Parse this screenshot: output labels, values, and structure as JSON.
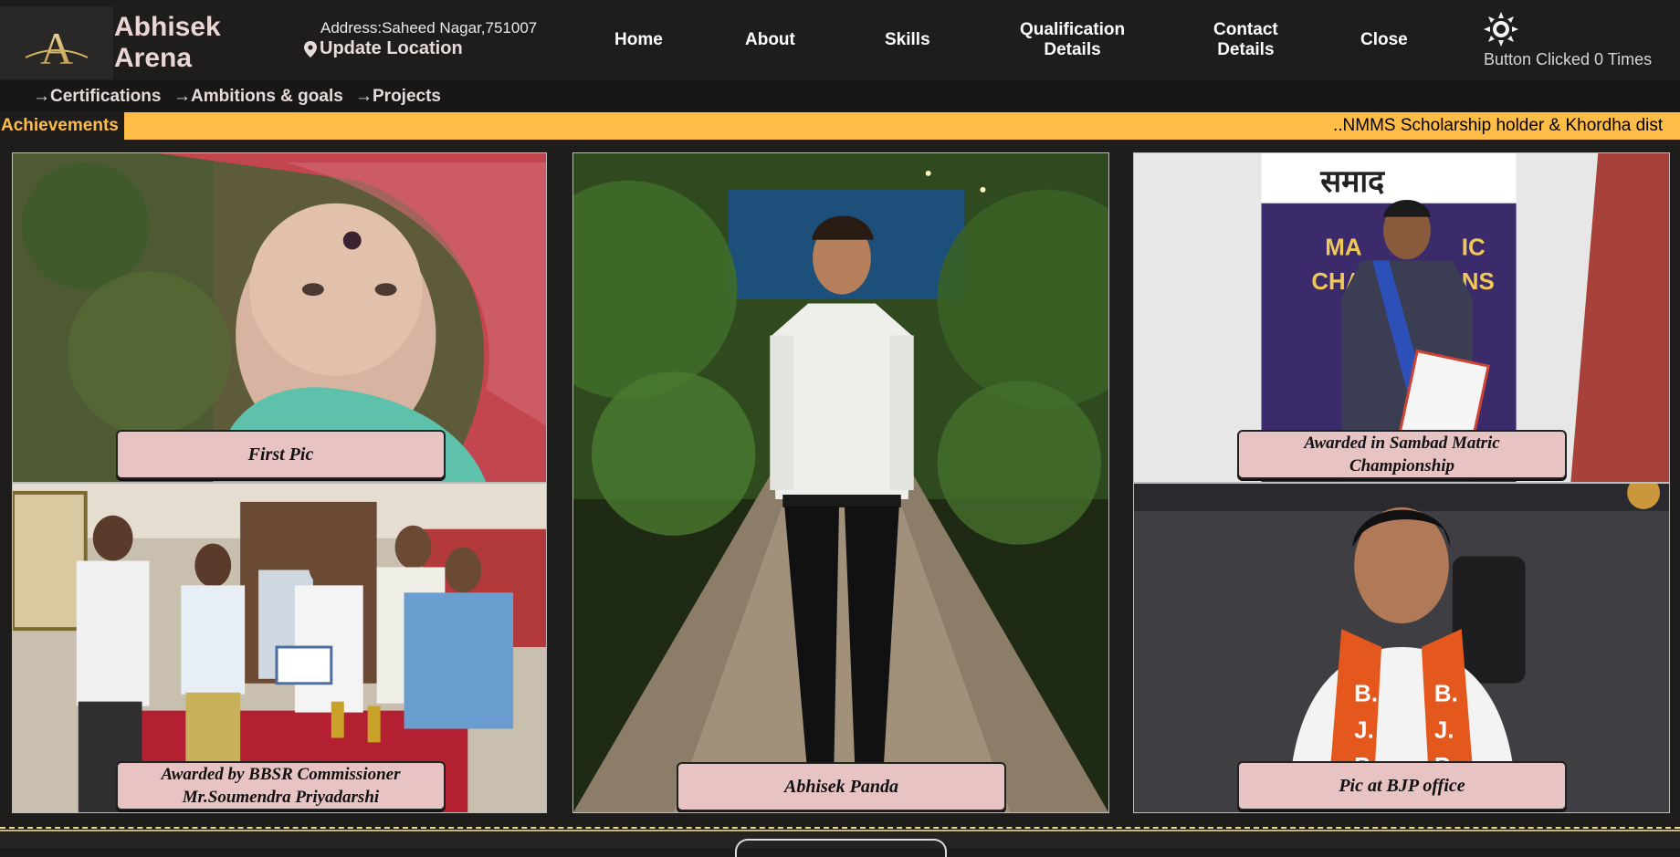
{
  "brand": {
    "line1": "Abhisek",
    "line2": "Arena",
    "logo_letter": "A"
  },
  "address": {
    "text": "Address:Saheed Nagar,751007",
    "update_label": "Update Location"
  },
  "nav": {
    "home": "Home",
    "about": "About",
    "skills": "Skills",
    "qualification_line1": "Qualification",
    "qualification_line2": "Details",
    "contact_line1": "Contact",
    "contact_line2": "Details",
    "close": "Close"
  },
  "theme_toggle": {
    "icon": "sun-icon",
    "click_text": "Button Clicked 0 Times"
  },
  "subnav": {
    "certifications": "→Certifications",
    "ambitions": "→Ambitions & goals",
    "projects": "→Projects"
  },
  "ticker": {
    "label": "Achievements",
    "text": "..NMMS Scholarship holder & Khordha dist"
  },
  "gallery": {
    "first_pic": "First Pic",
    "commissioner_line1": "Awarded by BBSR Commissioner",
    "commissioner_line2": "Mr.Soumendra Priyadarshi",
    "center_name": "Abhisek Panda",
    "sambad_line1": "Awarded in Sambad Matric",
    "sambad_line2": "Championship",
    "bjp": "Pic at BJP office"
  },
  "colors": {
    "ticker_bg": "#ffbd48",
    "caption_bg": "#e8c3c4",
    "page_bg": "#1e1d1c"
  }
}
